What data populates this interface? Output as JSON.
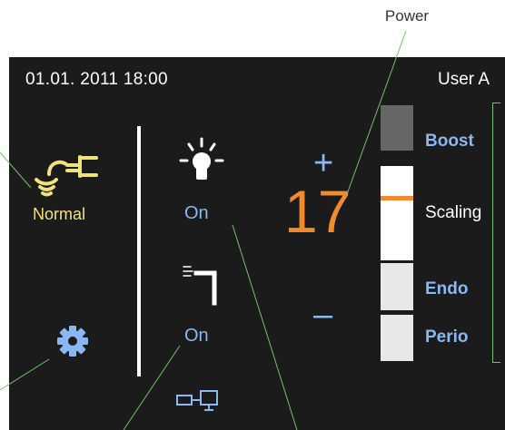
{
  "callout": {
    "title": "Power"
  },
  "status_bar": {
    "datetime": "01.01. 2011 18:00",
    "user": "User A"
  },
  "instrument": {
    "mode_label": "Normal"
  },
  "light": {
    "status": "On"
  },
  "spray": {
    "status": "On"
  },
  "power": {
    "value": "17",
    "plus_label": "+",
    "minus_label": "–"
  },
  "modes": [
    {
      "label": "Boost",
      "state": "inactive"
    },
    {
      "label": "Scaling",
      "state": "active"
    },
    {
      "label": "Endo",
      "state": "inactive"
    },
    {
      "label": "Perio",
      "state": "inactive"
    }
  ],
  "icons": {
    "instrument": "ultrasonic-handpiece-icon",
    "settings": "gear-icon",
    "light": "light-bulb-icon",
    "spray": "water-spray-icon",
    "network": "network-icon"
  },
  "colors": {
    "screen_bg": "#1b1b1b",
    "accent_blue": "#8ab8f2",
    "accent_orange": "#f08a2c",
    "accent_yellow": "#f2e27a",
    "callout_green": "#73c26a"
  }
}
